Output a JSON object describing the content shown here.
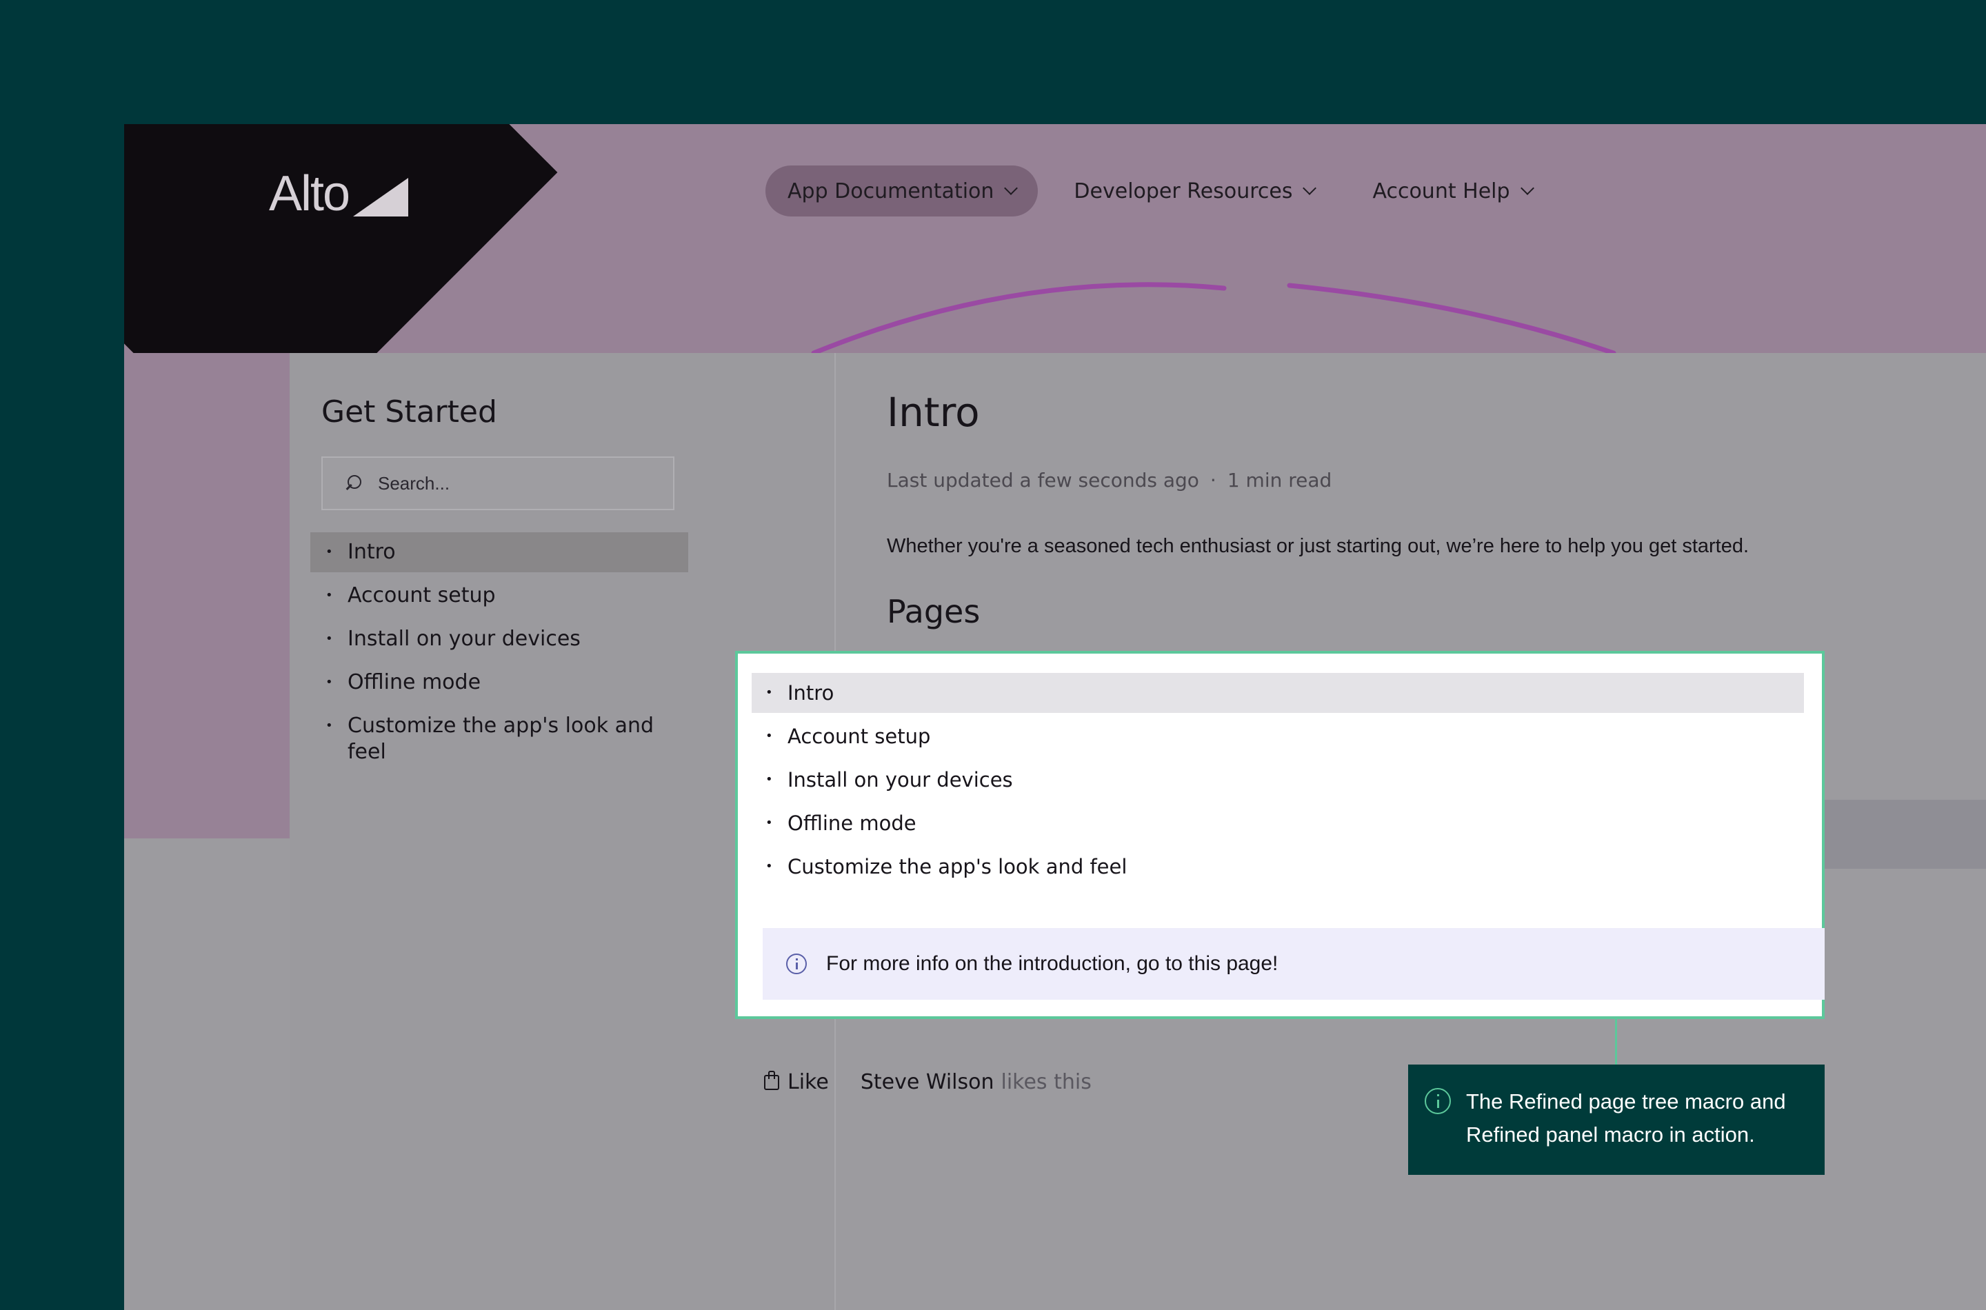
{
  "header": {
    "logo_text": "Alto",
    "nav": [
      {
        "label": "App Documentation"
      },
      {
        "label": "Developer Resources"
      },
      {
        "label": "Account Help"
      }
    ]
  },
  "sidebar": {
    "title": "Get Started",
    "search_placeholder": "Search...",
    "items": [
      {
        "label": "Intro"
      },
      {
        "label": "Account setup"
      },
      {
        "label": "Install on your devices"
      },
      {
        "label": "Offline mode"
      },
      {
        "label": "Customize the app's look and feel"
      }
    ]
  },
  "page": {
    "title": "Intro",
    "last_updated": "Last updated a few seconds ago",
    "read_time": "1 min read",
    "intro": "Whether you're a seasoned tech enthusiast or just starting out, we’re here to help you get started.",
    "pages_heading": "Pages",
    "tree_items": [
      {
        "label": "Intro"
      },
      {
        "label": "Account setup"
      },
      {
        "label": "Install on your devices"
      },
      {
        "label": "Offline mode"
      },
      {
        "label": "Customize the app's look and feel"
      }
    ],
    "info_panel": "For more info on the introduction, go to this page!",
    "like_label": "Like",
    "liker_name": "Steve Wilson",
    "likes_suffix": "likes this"
  },
  "callout": {
    "text": "The Refined page tree macro and Refined panel macro in action."
  },
  "colors": {
    "background": "#00373a",
    "accent_border": "#5cc89b",
    "callout_bg": "#003b3a",
    "info_panel_bg": "#eeedfb"
  }
}
